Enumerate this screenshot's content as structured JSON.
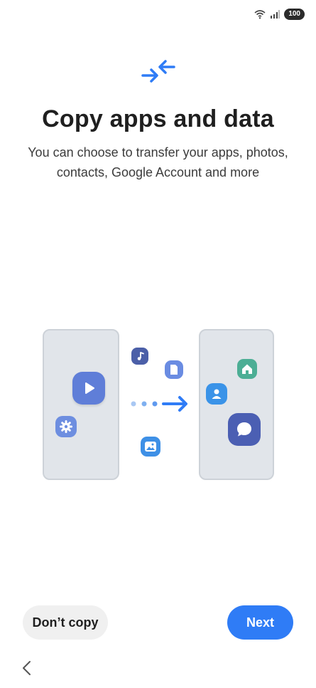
{
  "status_bar": {
    "battery": "100",
    "icons": [
      "wifi-icon",
      "signal-icon"
    ]
  },
  "header": {
    "icon": "transfer-arrows-icon",
    "title": "Copy apps and data",
    "subtitle": "You can choose to transfer your apps, photos, contacts, Google Account and more"
  },
  "illustration": {
    "icons": [
      "play-icon",
      "gear-icon",
      "music-note-icon",
      "document-icon",
      "image-icon",
      "home-icon",
      "contact-icon",
      "chat-icon"
    ]
  },
  "buttons": {
    "dont_copy": "Don’t copy",
    "next": "Next"
  },
  "nav": {
    "back_icon": "back-chevron-icon"
  },
  "colors": {
    "accent": "#2f7cf6",
    "phone": "#e1e5ea"
  }
}
